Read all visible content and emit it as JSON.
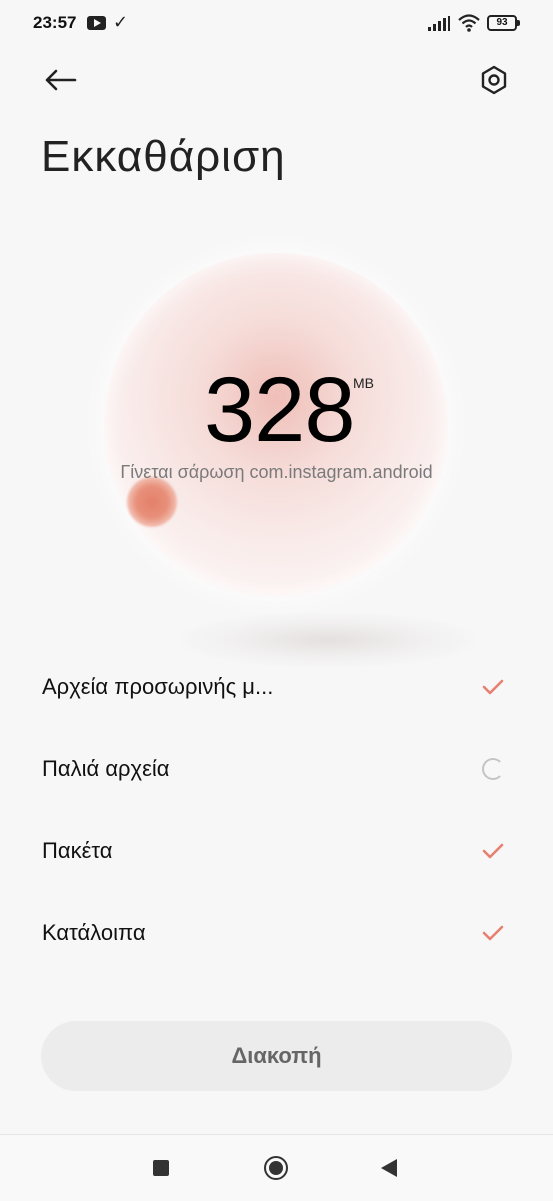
{
  "status_bar": {
    "time": "23:57",
    "battery": "93",
    "icons": [
      "youtube-icon",
      "download-check-icon",
      "signal-icon",
      "wifi-icon",
      "battery-icon"
    ]
  },
  "header": {
    "back_icon": "back-arrow-icon",
    "settings_icon": "settings-hex-icon",
    "title": "Εκκαθάριση"
  },
  "scan": {
    "size_value": "328",
    "size_unit": "MB",
    "status_text": "Γίνεται σάρωση com.instagram.android"
  },
  "items": [
    {
      "label": "Αρχεία προσωρινής μ...",
      "status": "done"
    },
    {
      "label": "Παλιά αρχεία",
      "status": "scanning"
    },
    {
      "label": "Πακέτα",
      "status": "done"
    },
    {
      "label": "Κατάλοιπα",
      "status": "done"
    }
  ],
  "actions": {
    "stop_label": "Διακοπή"
  },
  "colors": {
    "accent": "#e8806f",
    "background": "#f7f7f7",
    "button_bg": "#ececec"
  }
}
